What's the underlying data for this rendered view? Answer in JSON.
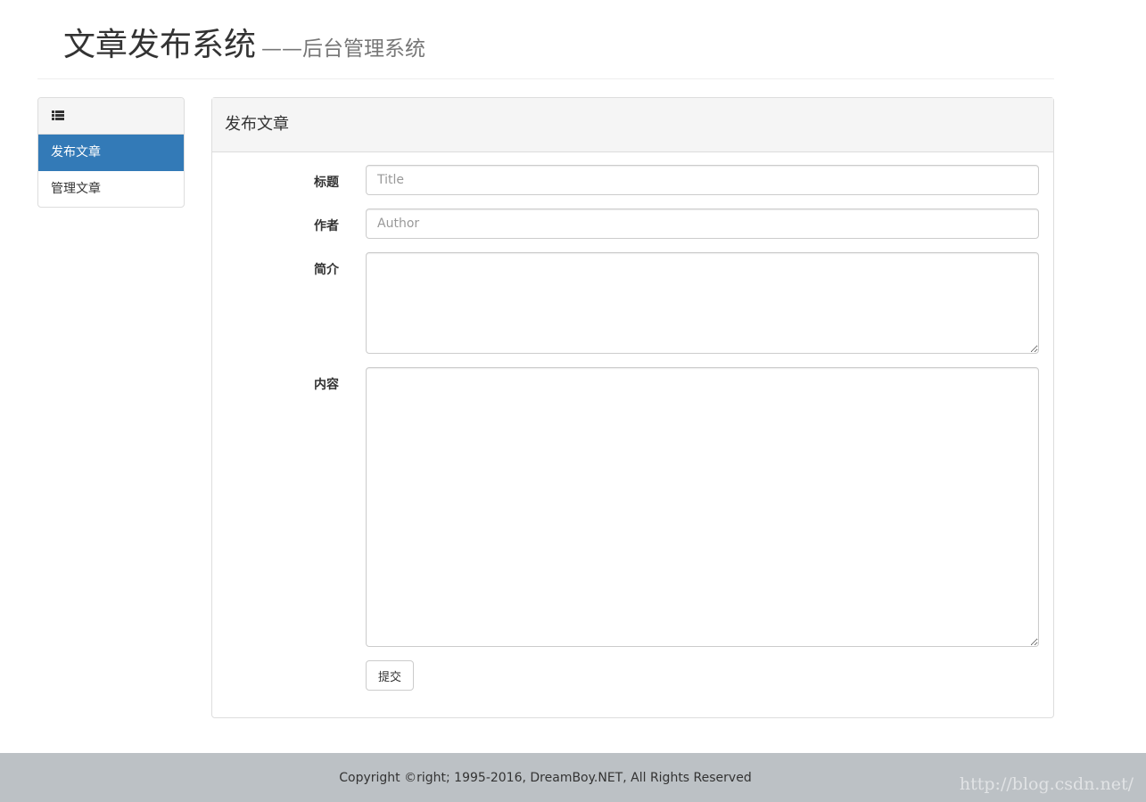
{
  "header": {
    "title": "文章发布系统",
    "subtitle": "——后台管理系统"
  },
  "sidebar": {
    "heading_icon": "list-icon",
    "items": [
      {
        "label": "发布文章",
        "active": true
      },
      {
        "label": "管理文章",
        "active": false
      }
    ]
  },
  "panel": {
    "title": "发布文章"
  },
  "form": {
    "title_label": "标题",
    "title_placeholder": "Title",
    "author_label": "作者",
    "author_placeholder": "Author",
    "summary_label": "简介",
    "content_label": "内容",
    "submit_label": "提交"
  },
  "footer": {
    "copyright": "Copyright ©right; 1995-2016, DreamBoy.NET, All Rights Reserved",
    "watermark": "http://blog.csdn.net/"
  },
  "colors": {
    "accent": "#337ab7",
    "footer_bg": "#bcc1c5",
    "panel_heading_bg": "#f5f5f5"
  }
}
